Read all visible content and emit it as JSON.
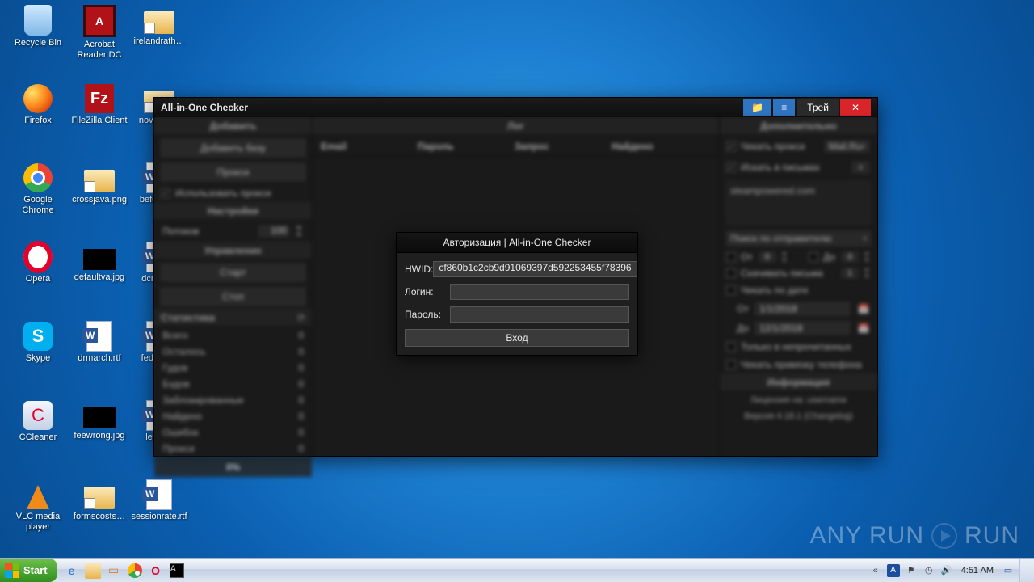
{
  "desktop_icons": {
    "recycle_bin": "Recycle Bin",
    "acrobat": "Acrobat Reader DC",
    "irelandrath": "irelandrath…",
    "firefox": "Firefox",
    "filezilla": "FileZilla Client",
    "november": "novemb…",
    "chrome": "Google Chrome",
    "crossjava": "crossjava.png",
    "beforea": "beforea…",
    "opera": "Opera",
    "defaultva": "defaultva.jpg",
    "dcmov": "dcmov…",
    "skype": "Skype",
    "drmarch": "drmarch.rtf",
    "federal": "federal…",
    "ccleaner": "CCleaner",
    "feewrong": "feewrong.jpg",
    "lewa": "lewa…",
    "vlc": "VLC media player",
    "formscosts": "formscosts…",
    "sessionrate": "sessionrate.rtf"
  },
  "app": {
    "title": "All-in-One Checker",
    "tray_btn": "Трей",
    "left": {
      "add_header": "Добавить",
      "add_base": "Добавить базу",
      "proxy": "Прокси",
      "use_proxy": "Использовать прокси",
      "settings_header": "Настройки",
      "threads_label": "Потоков",
      "threads_value": "100",
      "control_header": "Управление",
      "start": "Старт",
      "stop": "Стоп",
      "stats_header": "Статистика",
      "stats": {
        "all": "Всего",
        "all_v": "0",
        "left": "Осталось",
        "left_v": "0",
        "good": "Гудов",
        "good_v": "0",
        "bad": "Бэдов",
        "bad_v": "0",
        "blocked": "Заблокированные",
        "blocked_v": "0",
        "found": "Найдено",
        "found_v": "0",
        "errors": "Ошибок",
        "errors_v": "0",
        "proxy": "Прокси",
        "proxy_v": "0"
      },
      "progress": "0%"
    },
    "center": {
      "log_header": "Лог",
      "col_email": "Email",
      "col_pass": "Пароль",
      "col_req": "Запрос",
      "col_found": "Найдено"
    },
    "right": {
      "extra_header": "Дополнительно",
      "check_proxy": "Чекать прокси",
      "mailru": "Mail.Ru",
      "search_mail": "Искать в письмах",
      "plus": "+",
      "steam": "steampowered.com",
      "search_sender": "Поиск по отправителю",
      "from": "От",
      "from_v": "0",
      "to": "До",
      "to_v": "0",
      "download_mail": "Скачивать письма",
      "download_v": "1",
      "check_date": "Чекать по дате",
      "date_from": "От",
      "date_from_v": "1/1/2018",
      "date_to": "До",
      "date_to_v": "12/1/2018",
      "unread": "Только в непрочитанных",
      "phone": "Чекать привязку телефона",
      "info_header": "Информация",
      "license1": "Лицензия на: username",
      "license2": "Версия 4.18.1 (Changelog)"
    }
  },
  "modal": {
    "title": "Авторизация | All-in-One Checker",
    "hwid_label": "HWID:",
    "hwid_value": "cf860b1c2cb9d91069397d592253455f78396",
    "login_label": "Логин:",
    "pass_label": "Пароль:",
    "enter": "Вход"
  },
  "watermark": "ANY RUN",
  "taskbar": {
    "start": "Start",
    "clock": "4:51 AM"
  }
}
